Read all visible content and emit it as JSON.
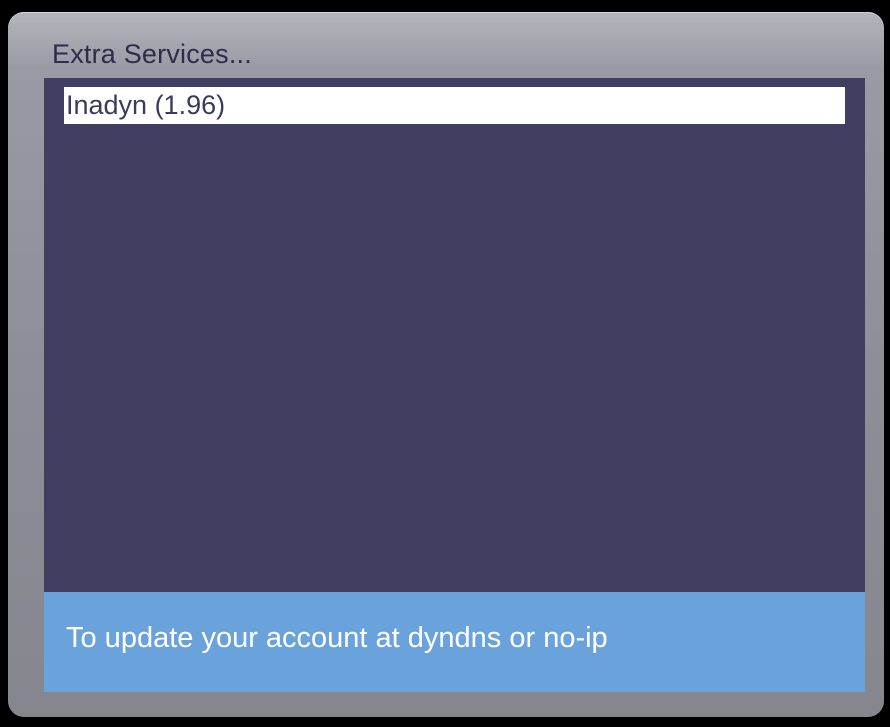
{
  "window": {
    "title": "Extra Services..."
  },
  "service_list": {
    "items": [
      {
        "label": "Inadyn (1.96)",
        "selected": true
      }
    ]
  },
  "description": {
    "text": "To update your account at dyndns or no-ip"
  },
  "colors": {
    "background": "#000000",
    "frame": "#8e8e98",
    "list_background": "#403f62",
    "selection": "#ffffff",
    "description_background": "#6aa3dc",
    "title_text": "#2c2c4c"
  }
}
